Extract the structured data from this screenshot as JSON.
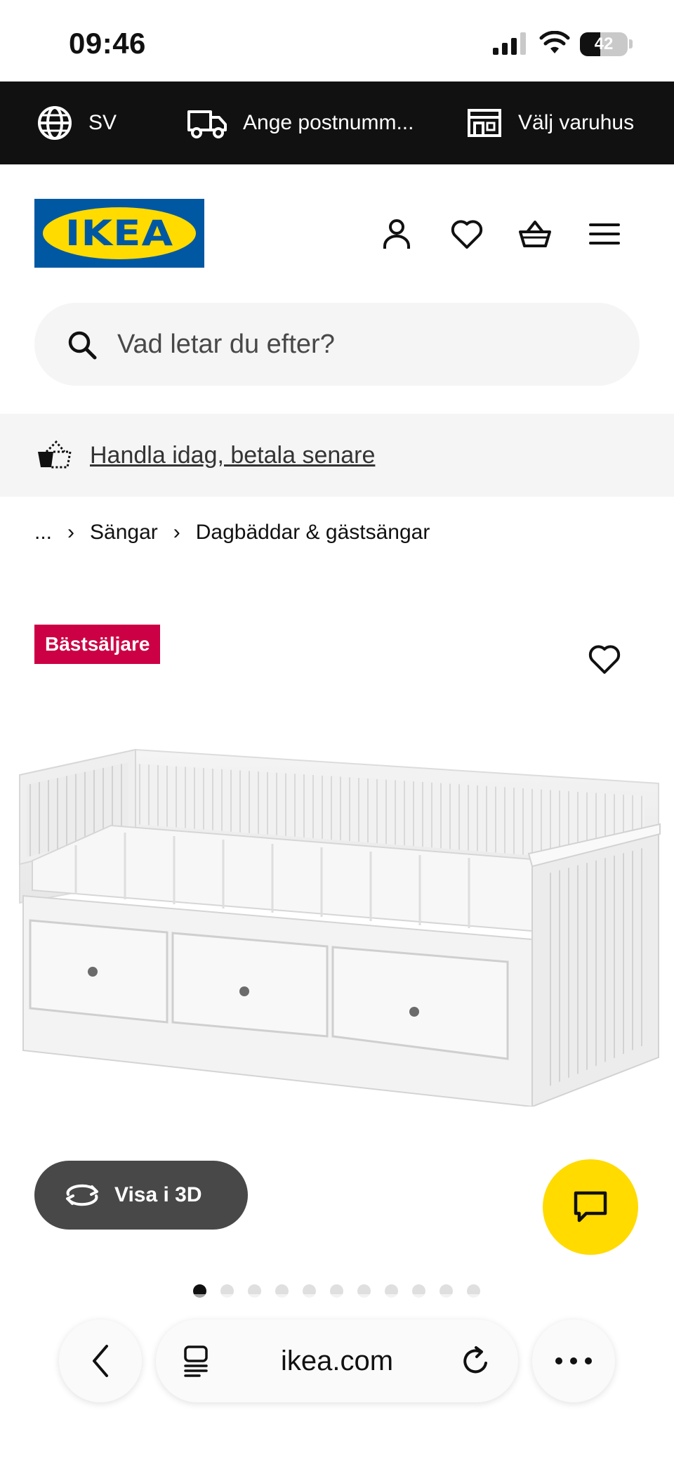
{
  "status_bar": {
    "time": "09:46",
    "battery": "42",
    "battery_level": 0.42
  },
  "top_bar": {
    "language": "SV",
    "postcode": "Ange postnumm...",
    "store": "Välj varuhus"
  },
  "header": {
    "logo_text": "IKEA"
  },
  "search": {
    "placeholder": "Vad letar du efter?"
  },
  "finance_banner": {
    "link": "Handla idag, betala senare"
  },
  "breadcrumb": [
    "...",
    "Sängar",
    "Dagbäddar & gästsängar"
  ],
  "product": {
    "badge": "Bästsäljare",
    "view_3d_label": "Visa i 3D",
    "image_count": 11,
    "active_image": 0
  },
  "browser": {
    "url": "ikea.com"
  },
  "colors": {
    "ikea_blue": "#0058a3",
    "ikea_yellow": "#ffdb00",
    "badge_red": "#cc0044",
    "top_bar_bg": "#111111"
  }
}
